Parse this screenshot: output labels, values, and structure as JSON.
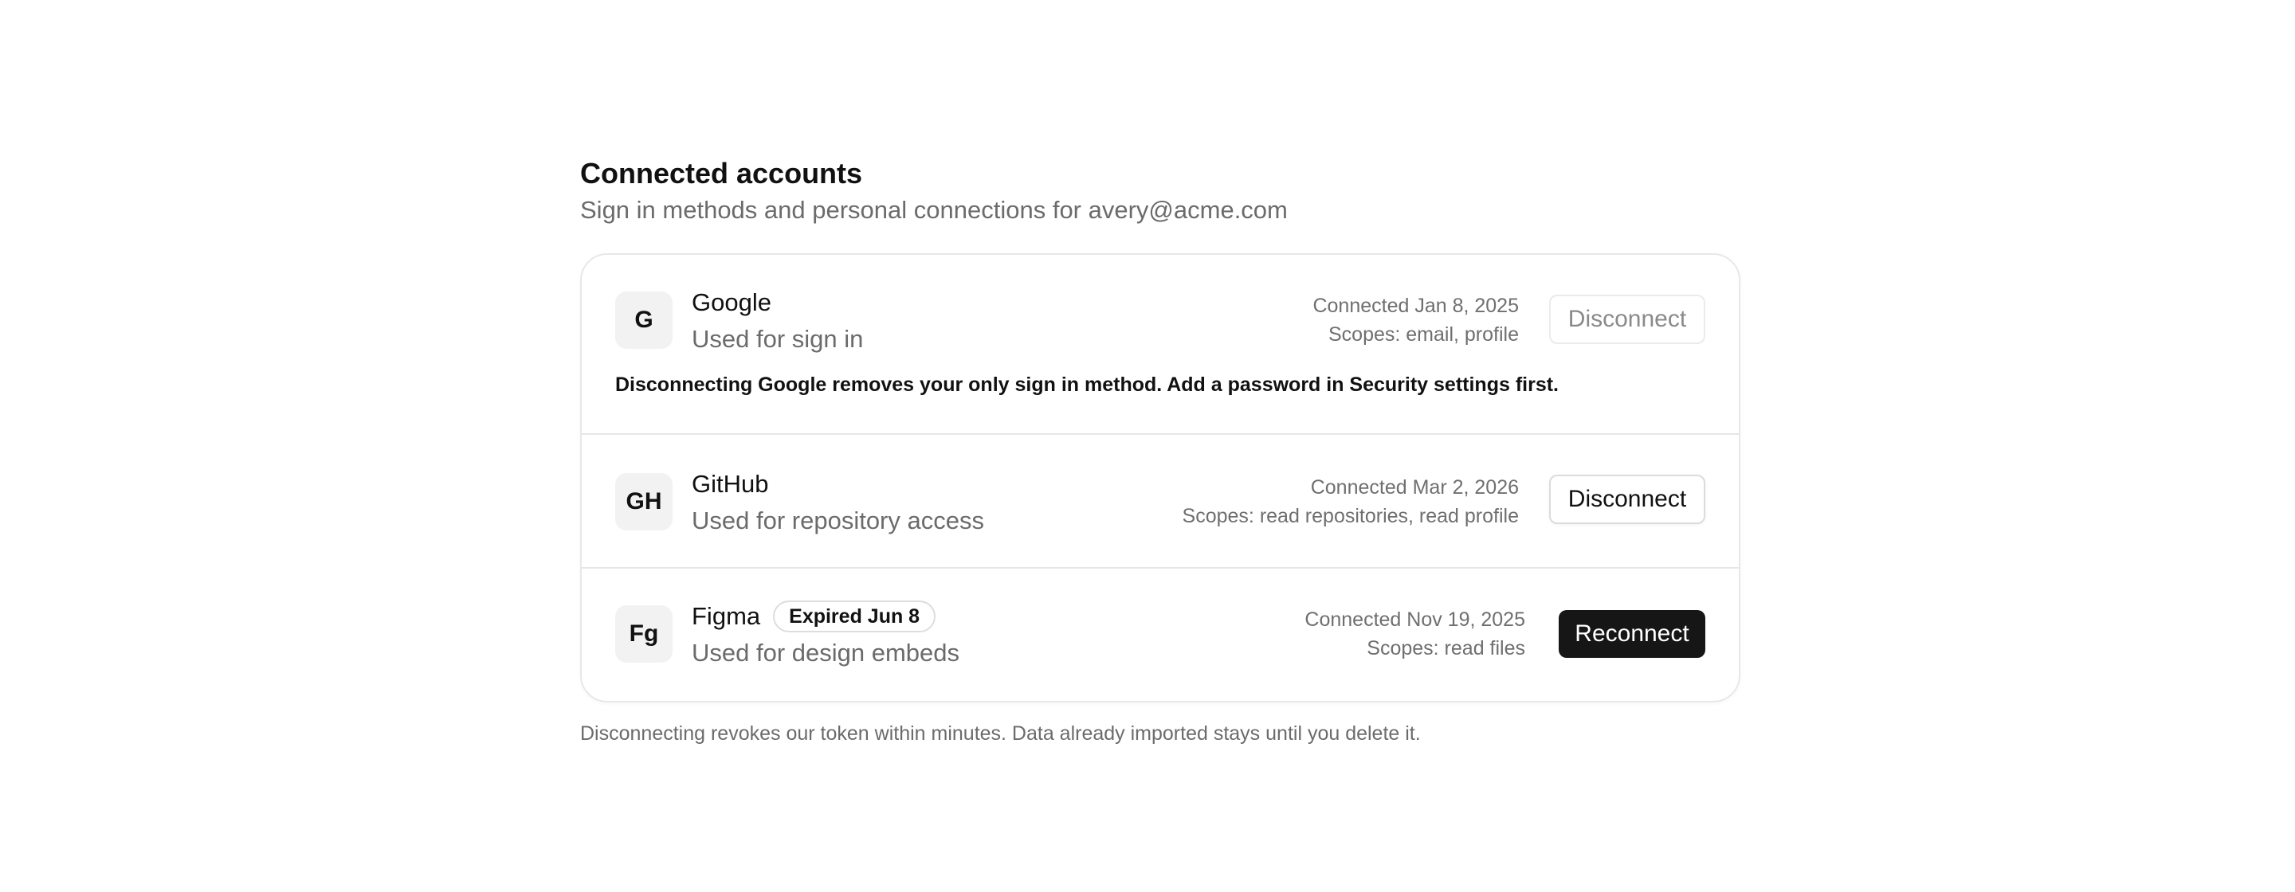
{
  "header": {
    "title": "Connected accounts",
    "subtitle": "Sign in methods and personal connections for avery@acme.com"
  },
  "accounts": [
    {
      "logo": "G",
      "name": "Google",
      "description": "Used for sign in",
      "connected": "Connected Jan 8, 2025",
      "scopes": "Scopes: email, profile",
      "action": "Disconnect",
      "action_state": "disabled",
      "warning": "Disconnecting Google removes your only sign in method. Add a password in Security settings first."
    },
    {
      "logo": "GH",
      "name": "GitHub",
      "description": "Used for repository access",
      "connected": "Connected Mar 2, 2026",
      "scopes": "Scopes: read repositories, read profile",
      "action": "Disconnect",
      "action_state": "enabled"
    },
    {
      "logo": "Fg",
      "name": "Figma",
      "badge": "Expired Jun 8",
      "description": "Used for design embeds",
      "connected": "Connected Nov 19, 2025",
      "scopes": "Scopes: read files",
      "action": "Reconnect",
      "action_state": "primary"
    }
  ],
  "footnote": "Disconnecting revokes our token within minutes. Data already imported stays until you delete it.",
  "colors": {
    "primary_button": "#161616",
    "muted_text": "#6b6b6b",
    "border": "#e8e8e8"
  }
}
